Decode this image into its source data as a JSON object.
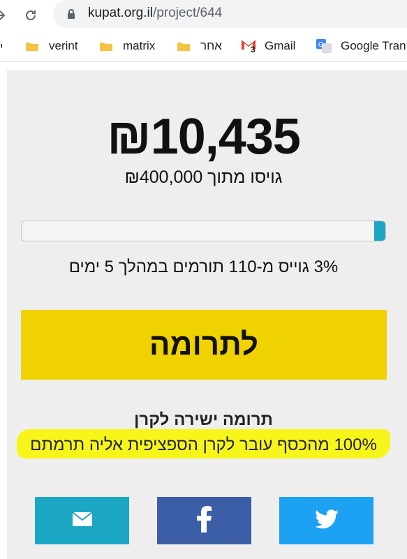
{
  "browser": {
    "url_host": "kupat.org.il",
    "url_path": "/project/644",
    "bookmarks": [
      {
        "label": "verint",
        "icon": "folder-icon"
      },
      {
        "label": "matrix",
        "icon": "folder-icon"
      },
      {
        "label": "אחר",
        "icon": "folder-icon"
      },
      {
        "label": "Gmail",
        "icon": "gmail-icon",
        "badge": "3"
      },
      {
        "label": "Google Tran",
        "icon": "google-translate-icon"
      }
    ],
    "bookmark_cut_label": "י"
  },
  "campaign": {
    "raised": "₪10,435",
    "goal_text": "גויסו מתוך ₪400,000",
    "progress_percent": 3,
    "stats_text": "3% גוייס מ-110 תורמים במהלך 5 ימים",
    "donate_label": "לתרומה",
    "direct_title": "תרומה ישירה לקרן",
    "direct_text": "100% מהכסף עובר לקרן הספציפית אליה תרמתם"
  },
  "share": [
    {
      "name": "email",
      "icon": "mail-icon",
      "color": "#1ba6c4"
    },
    {
      "name": "facebook",
      "icon": "facebook-icon",
      "color": "#3b5ea6"
    },
    {
      "name": "twitter",
      "icon": "twitter-icon",
      "color": "#1da1f2"
    }
  ],
  "colors": {
    "donate_button": "#f0d200",
    "progress_fill": "#1ba6c4",
    "highlight": "#f7f61a"
  }
}
